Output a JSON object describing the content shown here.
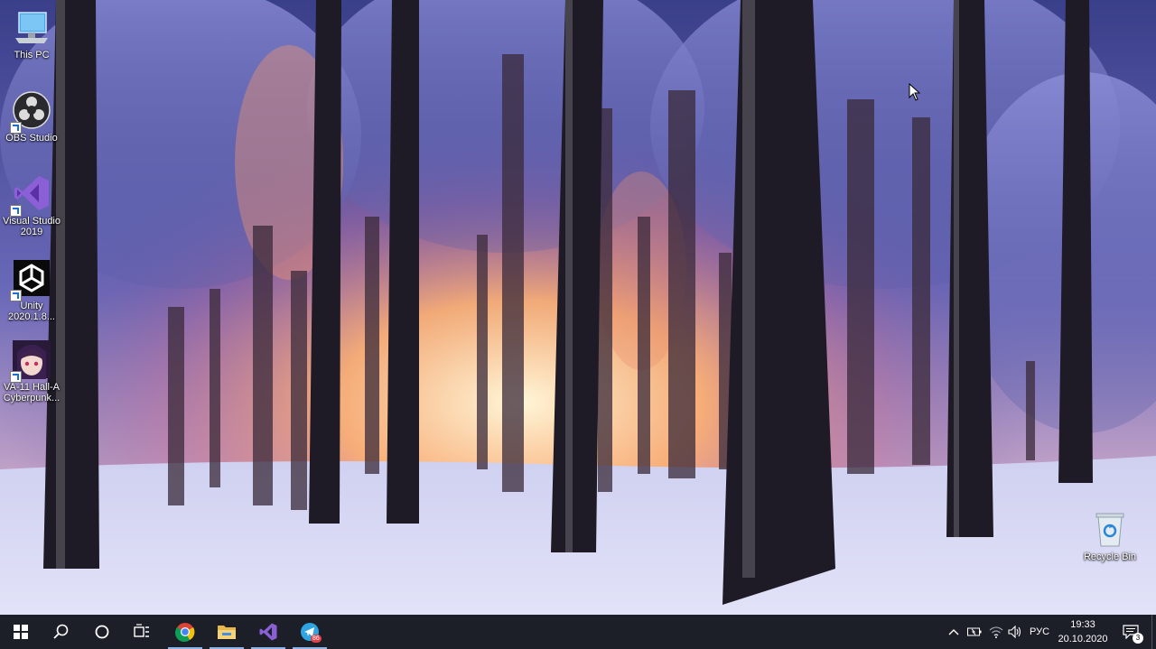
{
  "desktop": {
    "icons": [
      {
        "label": "This PC",
        "icon": "this-pc-icon"
      },
      {
        "label": "OBS Studio",
        "icon": "obs-icon"
      },
      {
        "label": "Visual Studio 2019",
        "icon": "visual-studio-icon"
      },
      {
        "label": "Unity 2020.1.8...",
        "icon": "unity-icon"
      },
      {
        "label": "VA-11 Hall-A Cyberpunk...",
        "icon": "va11-halla-icon"
      },
      {
        "label": "Recycle Bin",
        "icon": "recycle-bin-icon"
      }
    ],
    "wallpaper": "snowy-forest-sunset"
  },
  "taskbar": {
    "pinned": [
      "start-icon",
      "search-icon",
      "cortana-icon",
      "task-view-icon",
      "chrome-icon",
      "file-explorer-icon",
      "visual-studio-icon",
      "telegram-icon"
    ],
    "telegram_badge": "86",
    "tray": {
      "language": "РУС",
      "time": "19:33",
      "date": "20.10.2020",
      "notification_count": "3"
    }
  },
  "colors": {
    "taskbar": "#1c1f28",
    "accent": "#8fb4e8",
    "vs_purple": "#8b5fd6"
  }
}
